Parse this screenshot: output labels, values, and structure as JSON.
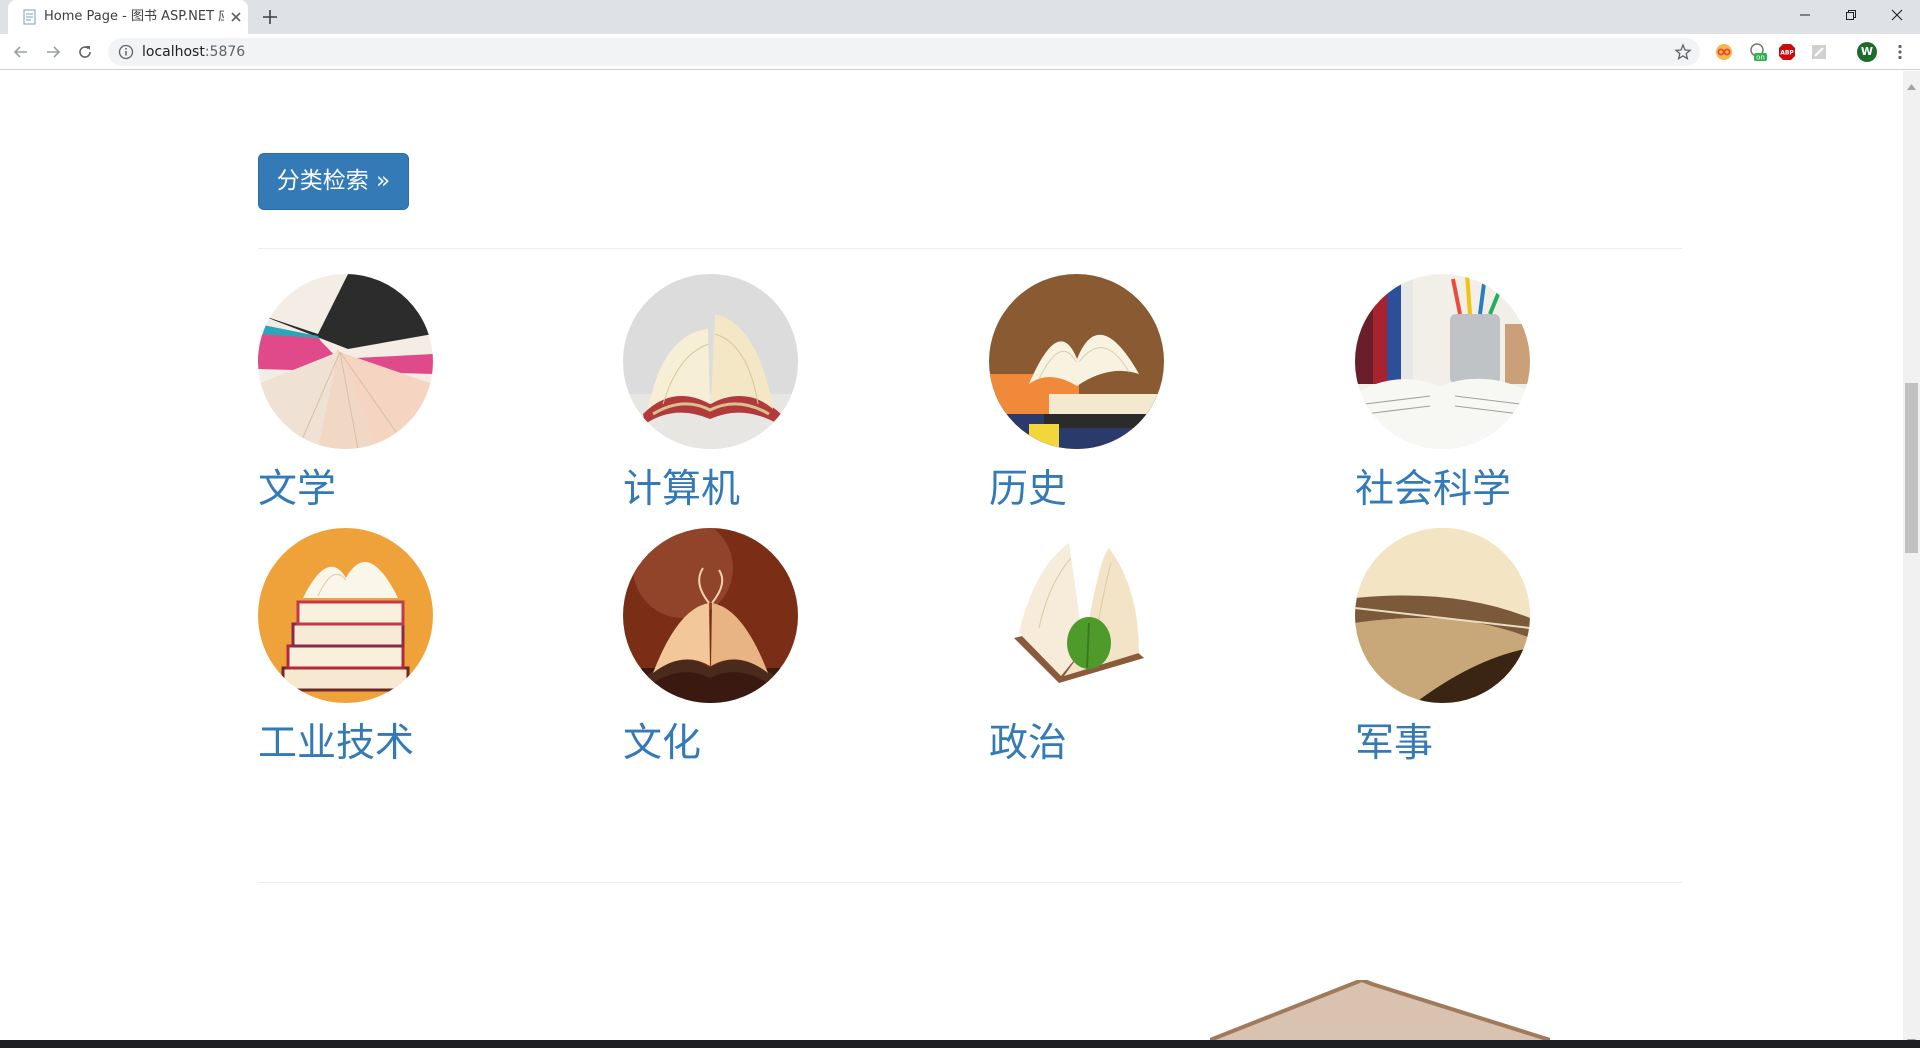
{
  "browser": {
    "tab_title": "Home Page - 图书 ASP.NET 应",
    "url_host": "localhost",
    "url_port": ":5876",
    "profile_initial": "W",
    "icons": {
      "favicon": "page-icon",
      "close": "close-icon",
      "new_tab": "plus-icon",
      "back": "arrow-left-icon",
      "forward": "arrow-right-icon",
      "reload": "reload-icon",
      "info": "info-icon",
      "bookmark": "star-icon",
      "menu": "more-vertical-icon"
    },
    "extensions": [
      "infinity-extension-icon",
      "on-toggle-extension-icon",
      "abp-extension-icon",
      "pdf-extension-icon"
    ]
  },
  "page": {
    "category_button_label": "分类检索 »",
    "accent_color": "#337ab7",
    "categories": [
      {
        "label": "文学",
        "image": "fanned-book-pages"
      },
      {
        "label": "计算机",
        "image": "open-book"
      },
      {
        "label": "历史",
        "image": "book-on-stack"
      },
      {
        "label": "社会科学",
        "image": "open-book-and-pencil-cup"
      },
      {
        "label": "工业技术",
        "image": "stack-of-books"
      },
      {
        "label": "文化",
        "image": "open-book-brown-background"
      },
      {
        "label": "政治",
        "image": "book-with-green-leaf"
      },
      {
        "label": "军事",
        "image": "book-closeup"
      }
    ]
  }
}
